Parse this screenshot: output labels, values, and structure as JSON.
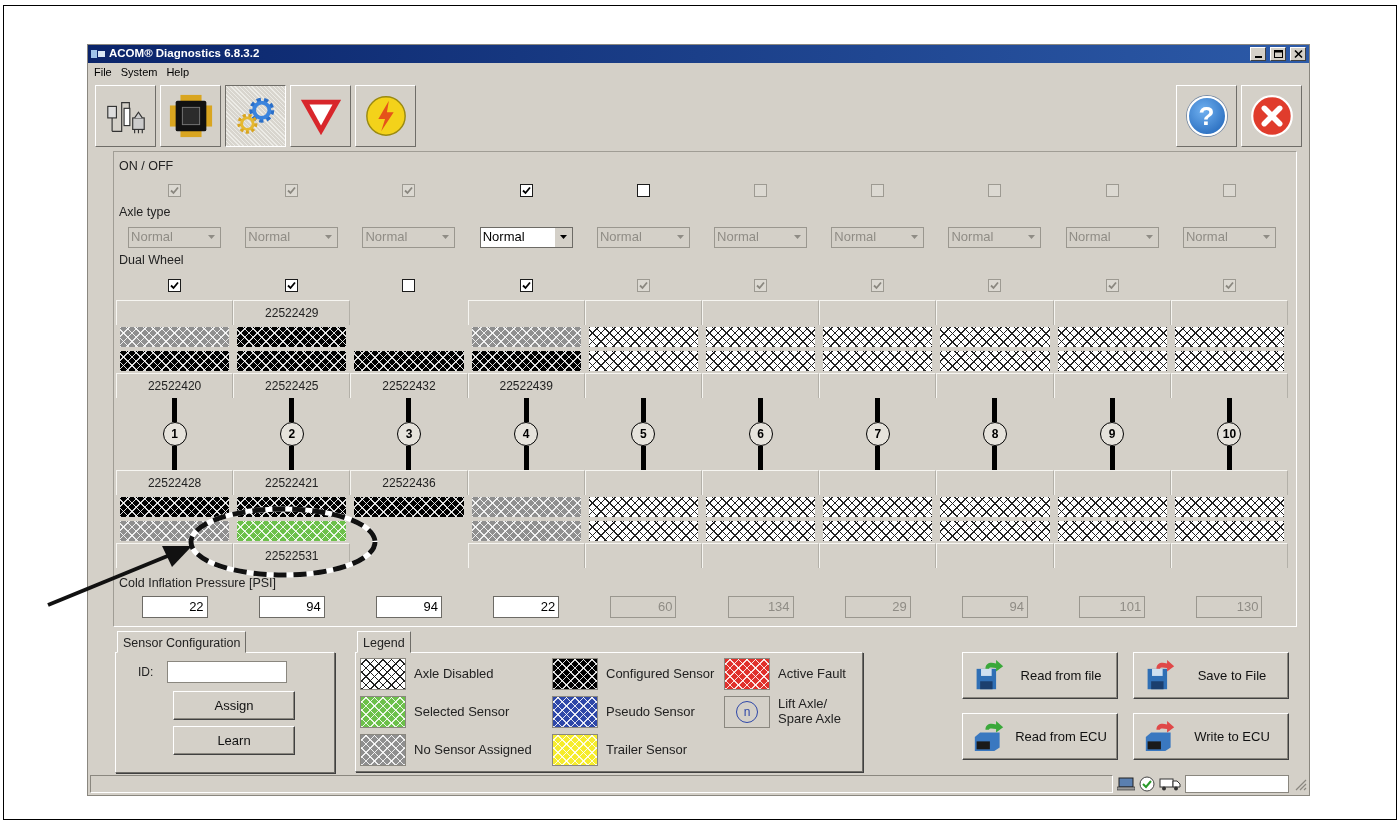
{
  "window": {
    "title": "ACOM® Diagnostics 6.8.3.2"
  },
  "menu": [
    "File",
    "System",
    "Help"
  ],
  "toolbar": [
    {
      "kind": "connector",
      "selected": false
    },
    {
      "kind": "chip",
      "selected": false
    },
    {
      "kind": "gears",
      "selected": true
    },
    {
      "kind": "yield",
      "selected": false
    },
    {
      "kind": "power",
      "selected": false
    }
  ],
  "help_button": {
    "glyph": "?"
  },
  "labels": {
    "on_off": "ON / OFF",
    "axle_type": "Axle type",
    "dual_wheel": "Dual Wheel",
    "pressure": "Cold Inflation Pressure [PSI]"
  },
  "axles": [
    {
      "number": "1",
      "on": {
        "checked": true,
        "disabled": true
      },
      "axle_type": {
        "value": "Normal",
        "disabled": true
      },
      "dual_wheel": {
        "checked": true,
        "disabled": false
      },
      "top_outer": {
        "kind": "none"
      },
      "top_inner": {
        "kind": "configured",
        "id": "22522420"
      },
      "bottom_inner": {
        "kind": "configured",
        "id": "22522428"
      },
      "bottom_outer": {
        "kind": "none"
      },
      "pressure": {
        "value": "22",
        "disabled": false
      }
    },
    {
      "number": "2",
      "on": {
        "checked": true,
        "disabled": true
      },
      "axle_type": {
        "value": "Normal",
        "disabled": true
      },
      "dual_wheel": {
        "checked": true,
        "disabled": false
      },
      "top_outer": {
        "kind": "configured",
        "id": "22522429"
      },
      "top_inner": {
        "kind": "configured",
        "id": "22522425"
      },
      "bottom_inner": {
        "kind": "configured",
        "id": "22522421"
      },
      "bottom_outer": {
        "kind": "selected",
        "id": "22522531"
      },
      "pressure": {
        "value": "94",
        "disabled": false
      }
    },
    {
      "number": "3",
      "on": {
        "checked": true,
        "disabled": true
      },
      "axle_type": {
        "value": "Normal",
        "disabled": true
      },
      "dual_wheel": {
        "checked": false,
        "disabled": false
      },
      "top_inner": {
        "kind": "configured",
        "id": "22522432"
      },
      "bottom_inner": {
        "kind": "configured",
        "id": "22522436"
      },
      "pressure": {
        "value": "94",
        "disabled": false
      }
    },
    {
      "number": "4",
      "on": {
        "checked": true,
        "disabled": false
      },
      "axle_type": {
        "value": "Normal",
        "disabled": false
      },
      "dual_wheel": {
        "checked": true,
        "disabled": false
      },
      "top_outer": {
        "kind": "none"
      },
      "top_inner": {
        "kind": "configured",
        "id": "22522439"
      },
      "bottom_inner": {
        "kind": "none"
      },
      "bottom_outer": {
        "kind": "none"
      },
      "pressure": {
        "value": "22",
        "disabled": false
      }
    },
    {
      "number": "5",
      "on": {
        "checked": false,
        "disabled": false
      },
      "axle_type": {
        "value": "Normal",
        "disabled": true
      },
      "dual_wheel": {
        "checked": true,
        "disabled": true
      },
      "top_outer": {
        "kind": "disabled"
      },
      "top_inner": {
        "kind": "disabled"
      },
      "bottom_inner": {
        "kind": "disabled"
      },
      "bottom_outer": {
        "kind": "disabled"
      },
      "pressure": {
        "value": "60",
        "disabled": true
      }
    },
    {
      "number": "6",
      "on": {
        "checked": false,
        "disabled": true
      },
      "axle_type": {
        "value": "Normal",
        "disabled": true
      },
      "dual_wheel": {
        "checked": true,
        "disabled": true
      },
      "top_outer": {
        "kind": "disabled"
      },
      "top_inner": {
        "kind": "disabled"
      },
      "bottom_inner": {
        "kind": "disabled"
      },
      "bottom_outer": {
        "kind": "disabled"
      },
      "pressure": {
        "value": "134",
        "disabled": true
      }
    },
    {
      "number": "7",
      "on": {
        "checked": false,
        "disabled": true
      },
      "axle_type": {
        "value": "Normal",
        "disabled": true
      },
      "dual_wheel": {
        "checked": true,
        "disabled": true
      },
      "top_outer": {
        "kind": "disabled"
      },
      "top_inner": {
        "kind": "disabled"
      },
      "bottom_inner": {
        "kind": "disabled"
      },
      "bottom_outer": {
        "kind": "disabled"
      },
      "pressure": {
        "value": "29",
        "disabled": true
      }
    },
    {
      "number": "8",
      "on": {
        "checked": false,
        "disabled": true
      },
      "axle_type": {
        "value": "Normal",
        "disabled": true
      },
      "dual_wheel": {
        "checked": true,
        "disabled": true
      },
      "top_outer": {
        "kind": "disabled"
      },
      "top_inner": {
        "kind": "disabled"
      },
      "bottom_inner": {
        "kind": "disabled"
      },
      "bottom_outer": {
        "kind": "disabled"
      },
      "pressure": {
        "value": "94",
        "disabled": true
      }
    },
    {
      "number": "9",
      "on": {
        "checked": false,
        "disabled": true
      },
      "axle_type": {
        "value": "Normal",
        "disabled": true
      },
      "dual_wheel": {
        "checked": true,
        "disabled": true
      },
      "top_outer": {
        "kind": "disabled"
      },
      "top_inner": {
        "kind": "disabled"
      },
      "bottom_inner": {
        "kind": "disabled"
      },
      "bottom_outer": {
        "kind": "disabled"
      },
      "pressure": {
        "value": "101",
        "disabled": true
      }
    },
    {
      "number": "10",
      "on": {
        "checked": false,
        "disabled": true
      },
      "axle_type": {
        "value": "Normal",
        "disabled": true
      },
      "dual_wheel": {
        "checked": true,
        "disabled": true
      },
      "top_outer": {
        "kind": "disabled"
      },
      "top_inner": {
        "kind": "disabled"
      },
      "bottom_inner": {
        "kind": "disabled"
      },
      "bottom_outer": {
        "kind": "disabled"
      },
      "pressure": {
        "value": "130",
        "disabled": true
      }
    }
  ],
  "sensor_config": {
    "tab": "Sensor Configuration",
    "id_label": "ID:",
    "buttons": [
      "Assign",
      "Learn"
    ]
  },
  "legend": {
    "tab": "Legend",
    "items": [
      {
        "label": "Axle Disabled",
        "kind": "pattern",
        "color": "#ffffff"
      },
      {
        "label": "Selected Sensor",
        "kind": "pattern",
        "color": "#6cc04a"
      },
      {
        "label": "No Sensor Assigned",
        "kind": "pattern",
        "color": "#8f8f8f"
      },
      {
        "label": "Configured Sensor",
        "kind": "pattern",
        "color": "#000000"
      },
      {
        "label": "Pseudo Sensor",
        "kind": "pattern",
        "color": "#2e47a8"
      },
      {
        "label": "Trailer Sensor",
        "kind": "pattern",
        "color": "#f6ec2c"
      },
      {
        "label": "Active Fault",
        "kind": "pattern",
        "color": "#e0302b"
      },
      {
        "label": "Lift Axle/ Spare Axle",
        "kind": "lift",
        "glyph": "n"
      }
    ]
  },
  "actions": [
    {
      "label": "Read from file",
      "kind": "file-read"
    },
    {
      "label": "Save to File",
      "kind": "file-save"
    },
    {
      "label": "Read from ECU",
      "kind": "ecu-read"
    },
    {
      "label": "Write to ECU",
      "kind": "ecu-write"
    }
  ]
}
